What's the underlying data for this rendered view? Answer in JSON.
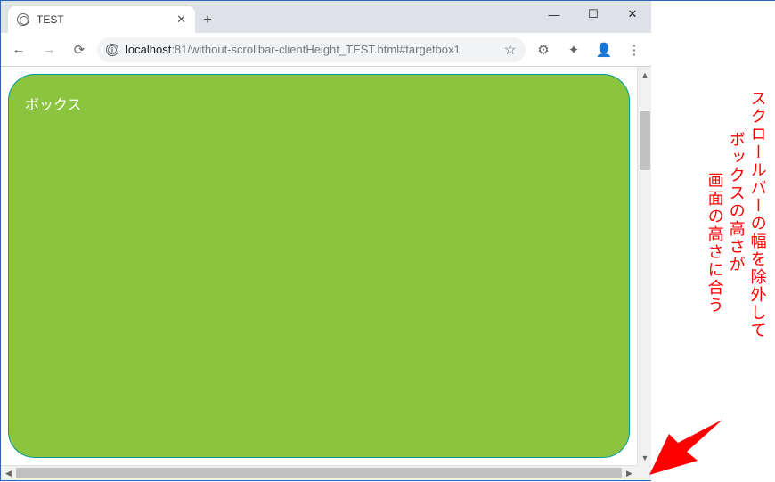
{
  "window": {
    "minimize": "—",
    "maximize": "☐",
    "close": "✕"
  },
  "tab": {
    "title": "TEST",
    "close": "✕",
    "newtab": "+"
  },
  "toolbar": {
    "back": "←",
    "forward": "→",
    "reload": "⟳",
    "site_info": "ⓘ",
    "star": "☆",
    "menu": "⋮"
  },
  "url": {
    "host": "localhost",
    "port_path": ":81/without-scrollbar-clientHeight_TEST.html#targetbox1"
  },
  "icons": {
    "ext1": "⚙",
    "ext2": "✦",
    "profile": "👤"
  },
  "page": {
    "box_label": "ボックス"
  },
  "scroll": {
    "up": "▲",
    "down": "▼",
    "left": "◀",
    "right": "▶",
    "v_thumb_top_pct": 8,
    "v_thumb_height_pct": 16
  },
  "annotation": {
    "line1": "スクロールバーの幅を除外して",
    "line2": "ボックスの高さが",
    "line3": "画面の高さに合う"
  }
}
